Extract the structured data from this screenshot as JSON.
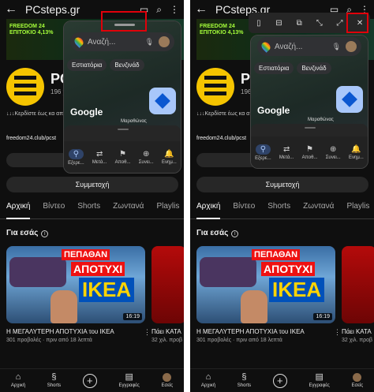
{
  "header": {
    "title": "PCsteps.gr"
  },
  "banner": {
    "lines": [
      "FREEDOM 24",
      "ΕΠΙΤΟΚΙΟ 4,13%"
    ]
  },
  "channel": {
    "name": "PC",
    "sub": "196 χ",
    "desc": "↓↓↓Κερδίστε έως κα αποταμίευσης↓↓↓",
    "link": "freedom24.club/pcst"
  },
  "share": {
    "label": "Συμμετοχή"
  },
  "tabs": [
    "Αρχική",
    "Βίντεο",
    "Shorts",
    "Ζωντανά",
    "Playlis"
  ],
  "foryou": {
    "label": "Για εσάς"
  },
  "video": {
    "thumb1": "ΠΕΠΑΘΑΝ",
    "thumb2": "ΑΠΟΤΥΧΙ",
    "thumb3": "IKEA",
    "duration": "16:19",
    "title": "Η ΜΕΓΑΛΥΤΕΡΗ ΑΠΟΤΥΧΙΑ του ΙΚΕΑ",
    "meta": "301 προβολές · πριν από 18 λεπτά"
  },
  "video2": {
    "title": "Πάει ΚΑΤΑ",
    "meta": "32 χιλ. προβ"
  },
  "nav": [
    "Αρχική",
    "Shorts",
    "",
    "Εγγραφές",
    "Εσείς"
  ],
  "maps": {
    "search_placeholder": "Αναζή...",
    "chip1": "Εστιατόρια",
    "chip2": "Βενζινάδ",
    "logo": "Google",
    "place": "Μαραθώνας",
    "nav": [
      "Εξερε...",
      "Μετά...",
      "Αποθ...",
      "Συνει...",
      "Ενημ..."
    ]
  },
  "maps_right": {
    "search_placeholder": "Αναζή..."
  },
  "icons": {
    "back": "←",
    "cast": "cast-icon",
    "search": "⌕",
    "more": "⋮"
  }
}
